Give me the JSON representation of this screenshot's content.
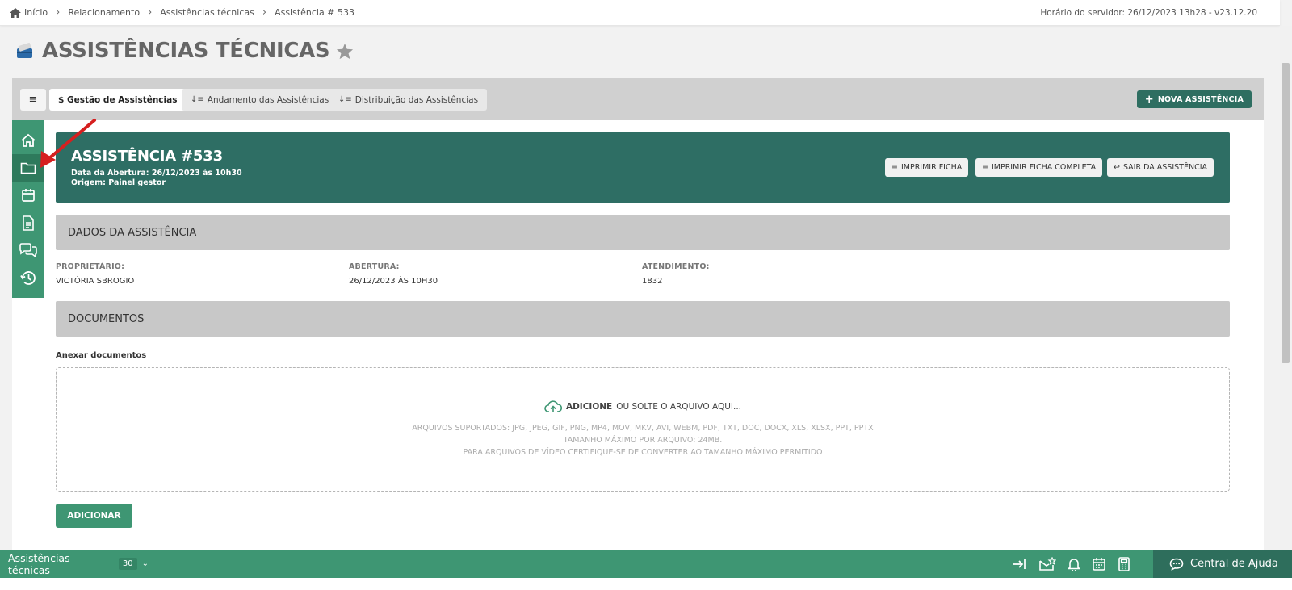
{
  "breadcrumb": {
    "items": [
      "Início",
      "Relacionamento",
      "Assistências técnicas",
      "Assistência # 533"
    ],
    "server_time": "Horário do servidor: 26/12/2023 13h28 - v23.12.20"
  },
  "page": {
    "title": "ASSISTÊNCIAS TÉCNICAS"
  },
  "tabs": [
    {
      "label": "$ Gestão de Assistências",
      "active": true
    },
    {
      "label": "Andamento das Assistências",
      "active": false
    },
    {
      "label": "Distribuição das Assistências",
      "active": false
    }
  ],
  "actions": {
    "nova": "NOVA ASSISTÊNCIA"
  },
  "assistance": {
    "title": "ASSISTÊNCIA #533",
    "opening": "Data da Abertura: 26/12/2023 às 10h30",
    "origin": "Origem: Painel gestor",
    "print": "IMPRIMIR FICHA",
    "print_full": "IMPRIMIR FICHA COMPLETA",
    "exit": "SAIR DA ASSISTÊNCIA"
  },
  "dados": {
    "title": "DADOS DA ASSISTÊNCIA",
    "fields": [
      {
        "label": "PROPRIETÁRIO:",
        "value": "VICTÓRIA SBROGIO"
      },
      {
        "label": "ABERTURA:",
        "value": "26/12/2023 ÀS 10H30"
      },
      {
        "label": "ATENDIMENTO:",
        "value": "1832"
      }
    ]
  },
  "documentos": {
    "title": "DOCUMENTOS",
    "attach_label": "Anexar documentos",
    "drop_bold": "ADICIONE",
    "drop_rest": "OU SOLTE O ARQUIVO AQUI...",
    "supported": "ARQUIVOS SUPORTADOS: JPG, JPEG, GIF, PNG, MP4, MOV, MKV, AVI, WEBM, PDF, TXT, DOC, DOCX, XLS, XLSX, PPT, PPTX",
    "max_size": "TAMANHO MÁXIMO POR ARQUIVO: 24MB.",
    "video_note": "PARA ARQUIVOS DE VÍDEO CERTIFIQUE-SE DE CONVERTER AO TAMANHO MÁXIMO PERMITIDO",
    "add_button": "ADICIONAR"
  },
  "footer": {
    "module": "Assistências técnicas",
    "count": "30",
    "help": "Central de Ajuda"
  },
  "colors": {
    "primary": "#3e9673",
    "header": "#2e6e64",
    "accent_arrow": "#d61f1f"
  }
}
